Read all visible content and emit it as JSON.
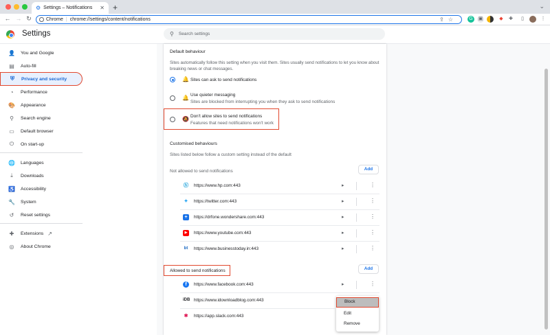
{
  "browser": {
    "tab_title": "Settings – Notifications",
    "new_tab_symbol": "+",
    "omnibox_origin": "Chrome",
    "omnibox_url": "chrome://settings/content/notifications"
  },
  "settings": {
    "title": "Settings",
    "search_placeholder": "Search settings"
  },
  "sidebar": {
    "items": [
      {
        "label": "You and Google",
        "icon": "person-icon"
      },
      {
        "label": "Auto-fill",
        "icon": "clipboard-icon"
      },
      {
        "label": "Privacy and security",
        "icon": "shield-icon"
      },
      {
        "label": "Performance",
        "icon": "speedometer-icon"
      },
      {
        "label": "Appearance",
        "icon": "palette-icon"
      },
      {
        "label": "Search engine",
        "icon": "search-icon"
      },
      {
        "label": "Default browser",
        "icon": "browser-icon"
      },
      {
        "label": "On start-up",
        "icon": "power-icon"
      },
      {
        "label": "Languages",
        "icon": "globe-icon"
      },
      {
        "label": "Downloads",
        "icon": "download-icon"
      },
      {
        "label": "Accessibility",
        "icon": "accessibility-icon"
      },
      {
        "label": "System",
        "icon": "wrench-icon"
      },
      {
        "label": "Reset settings",
        "icon": "reset-icon"
      },
      {
        "label": "Extensions",
        "icon": "puzzle-icon"
      },
      {
        "label": "About Chrome",
        "icon": "chrome-icon"
      }
    ]
  },
  "default_behaviour": {
    "heading": "Default behaviour",
    "description": "Sites automatically follow this setting when you visit them. Sites usually send notifications to let you know about breaking news or chat messages.",
    "options": [
      {
        "label": "Sites can ask to send notifications",
        "sub": "",
        "selected": true
      },
      {
        "label": "Use quieter messaging",
        "sub": "Sites are blocked from interrupting you when they ask to send notifications",
        "selected": false
      },
      {
        "label": "Don't allow sites to send notifications",
        "sub": "Features that need notifications won't work",
        "selected": false
      }
    ]
  },
  "customised": {
    "heading": "Customised behaviours",
    "description": "Sites listed below follow a custom setting instead of the default",
    "not_allowed_heading": "Not allowed to send notifications",
    "allowed_heading": "Allowed to send notifications",
    "add_label": "Add",
    "not_allowed_sites": [
      "https://www.hp.com:443",
      "https://twitter.com:443",
      "https://drfone.wondershare.com:443",
      "https://www.youtube.com:443",
      "https://www.businesstoday.in:443"
    ],
    "allowed_sites": [
      "https://www.facebook.com:443",
      "https://www.idownloadblog.com:443",
      "https://app.slack.com:443"
    ]
  },
  "context_menu": {
    "items": [
      "Block",
      "Edit",
      "Remove"
    ]
  },
  "colors": {
    "accent": "#1a73e8",
    "highlight_outline": "#e1462c",
    "active_nav_bg": "#e8f0fe"
  }
}
